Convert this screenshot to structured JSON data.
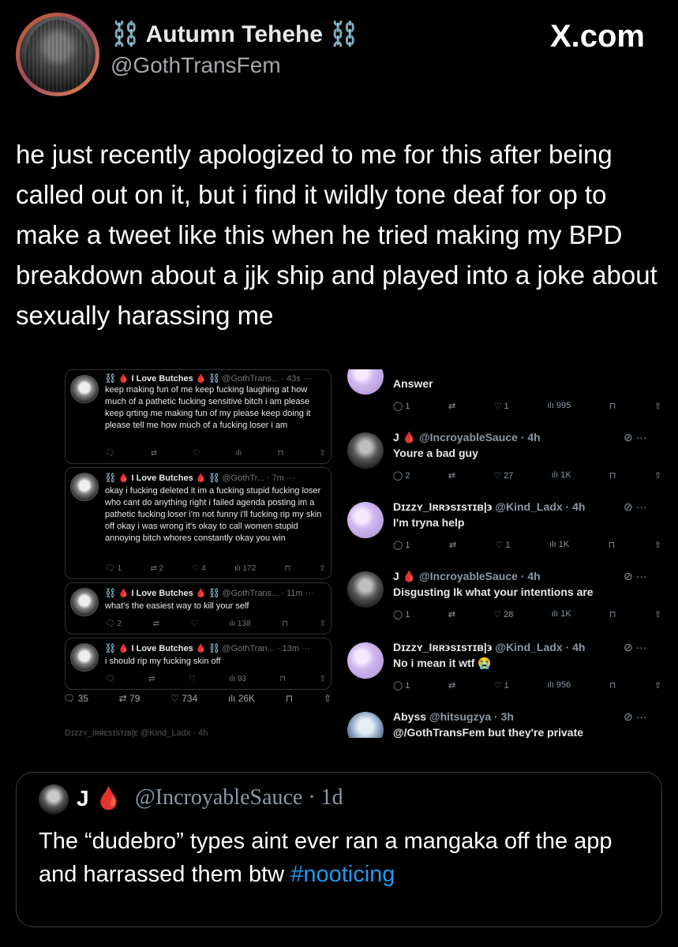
{
  "header": {
    "author_name": "⛓️ Autumn Tehehe ⛓️",
    "author_handle": "@GothTransFem",
    "site_logo": "X.com"
  },
  "tweet_text": "he just recently apologized to me for this after being called out on it, but i find it wildly tone deaf for op to make a tweet like this when he tried making my BPD breakdown about a jjk ship and played into a joke about sexually harassing me",
  "left_thread": {
    "replies": [
      {
        "name": "⛓️ 🩸 I Love Butches 🩸 ⛓️",
        "meta": "@GothTrans... · 43s ···",
        "text": "keep making fun of me keep fucking laughing at how much of a pathetic fucking sensitive bitch i am please keep qrting me making fun of my please keep doing it please tell me how much of a fucking loser i am",
        "replies": "",
        "reposts": "",
        "likes": "",
        "views": ""
      },
      {
        "name": "⛓️ 🩸 I Love Butches 🩸 ⛓️",
        "meta": "@GothTr... · 7m ···",
        "text": "okay i fucking deleted it im a fucking stupid fucking loser who cant do anything right i failed agenda posting im a pathetic fucking loser i'm not funny i'll fucking rip my skin off okay i was wrong it's okay to call women stupid annoying bitch whores constantly okay you win",
        "replies": "1",
        "reposts": "2",
        "likes": "4",
        "views": "172"
      },
      {
        "name": "⛓️ 🩸 I Love Butches 🩸 ⛓️",
        "meta": "@GothTrans... · 11m ···",
        "text": "what's the easiest way to kill your self",
        "replies": "2",
        "reposts": "",
        "likes": "",
        "views": "138"
      },
      {
        "name": "⛓️ 🩸 I Love Butches 🩸 ⛓️",
        "meta": "@GothTran... · 13m ···",
        "text": "i should rip my fucking skin off",
        "replies": "",
        "reposts": "",
        "likes": "",
        "views": "93"
      }
    ],
    "stats": {
      "replies": "35",
      "reposts": "79",
      "likes": "734",
      "views": "26K"
    },
    "cut_off_text": "Dɪzzʏ_Iʀʀᴇsɪsᴛɪʙ|ᴇ @Kind_Ladx · 4h"
  },
  "right_thread": {
    "replies": [
      {
        "name": "",
        "handle": "",
        "time": "",
        "text": "Answer",
        "replies": "1",
        "likes": "1",
        "views": "995"
      },
      {
        "name": "J 🩸",
        "handle": "@IncroyableSauce",
        "time": "4h",
        "text": "Youre a bad guy",
        "replies": "2",
        "likes": "27",
        "views": "1K"
      },
      {
        "name": "Dɪzzʏ_Iʀʀ϶sɪsᴛɪʙ|϶",
        "handle": "@Kind_Ladx",
        "time": "4h",
        "text": "I'm tryna help",
        "replies": "1",
        "likes": "1",
        "views": "1K"
      },
      {
        "name": "J 🩸",
        "handle": "@IncroyableSauce",
        "time": "4h",
        "text": "Disgusting Ik what your intentions are",
        "replies": "1",
        "likes": "28",
        "views": "1K"
      },
      {
        "name": "Dɪzzʏ_Iʀʀ϶sɪsᴛɪʙ|϶",
        "handle": "@Kind_Ladx",
        "time": "4h",
        "text": "No i mean it wtf 😭",
        "replies": "1",
        "likes": "1",
        "views": "956"
      },
      {
        "name": "Abyss",
        "handle": "@hitsugzya",
        "time": "3h",
        "text": "@/GothTransFem but they're private",
        "replies": "",
        "likes": "",
        "views": ""
      }
    ]
  },
  "quote": {
    "name": "J 🩸",
    "handle": "@IncroyableSauce · 1d",
    "text_before": "The “dudebro” types aint ever ran a mangaka off the app and harrassed them btw",
    "hashtag": "#nooticing"
  },
  "colors": {
    "background": "#000000",
    "link": "#1d9bf0",
    "muted": "#71767b",
    "blood": "#e0245e"
  },
  "icons": [
    "reply-icon",
    "repost-icon",
    "like-icon",
    "views-icon",
    "bookmark-icon",
    "share-icon",
    "grok-icon",
    "more-icon"
  ]
}
